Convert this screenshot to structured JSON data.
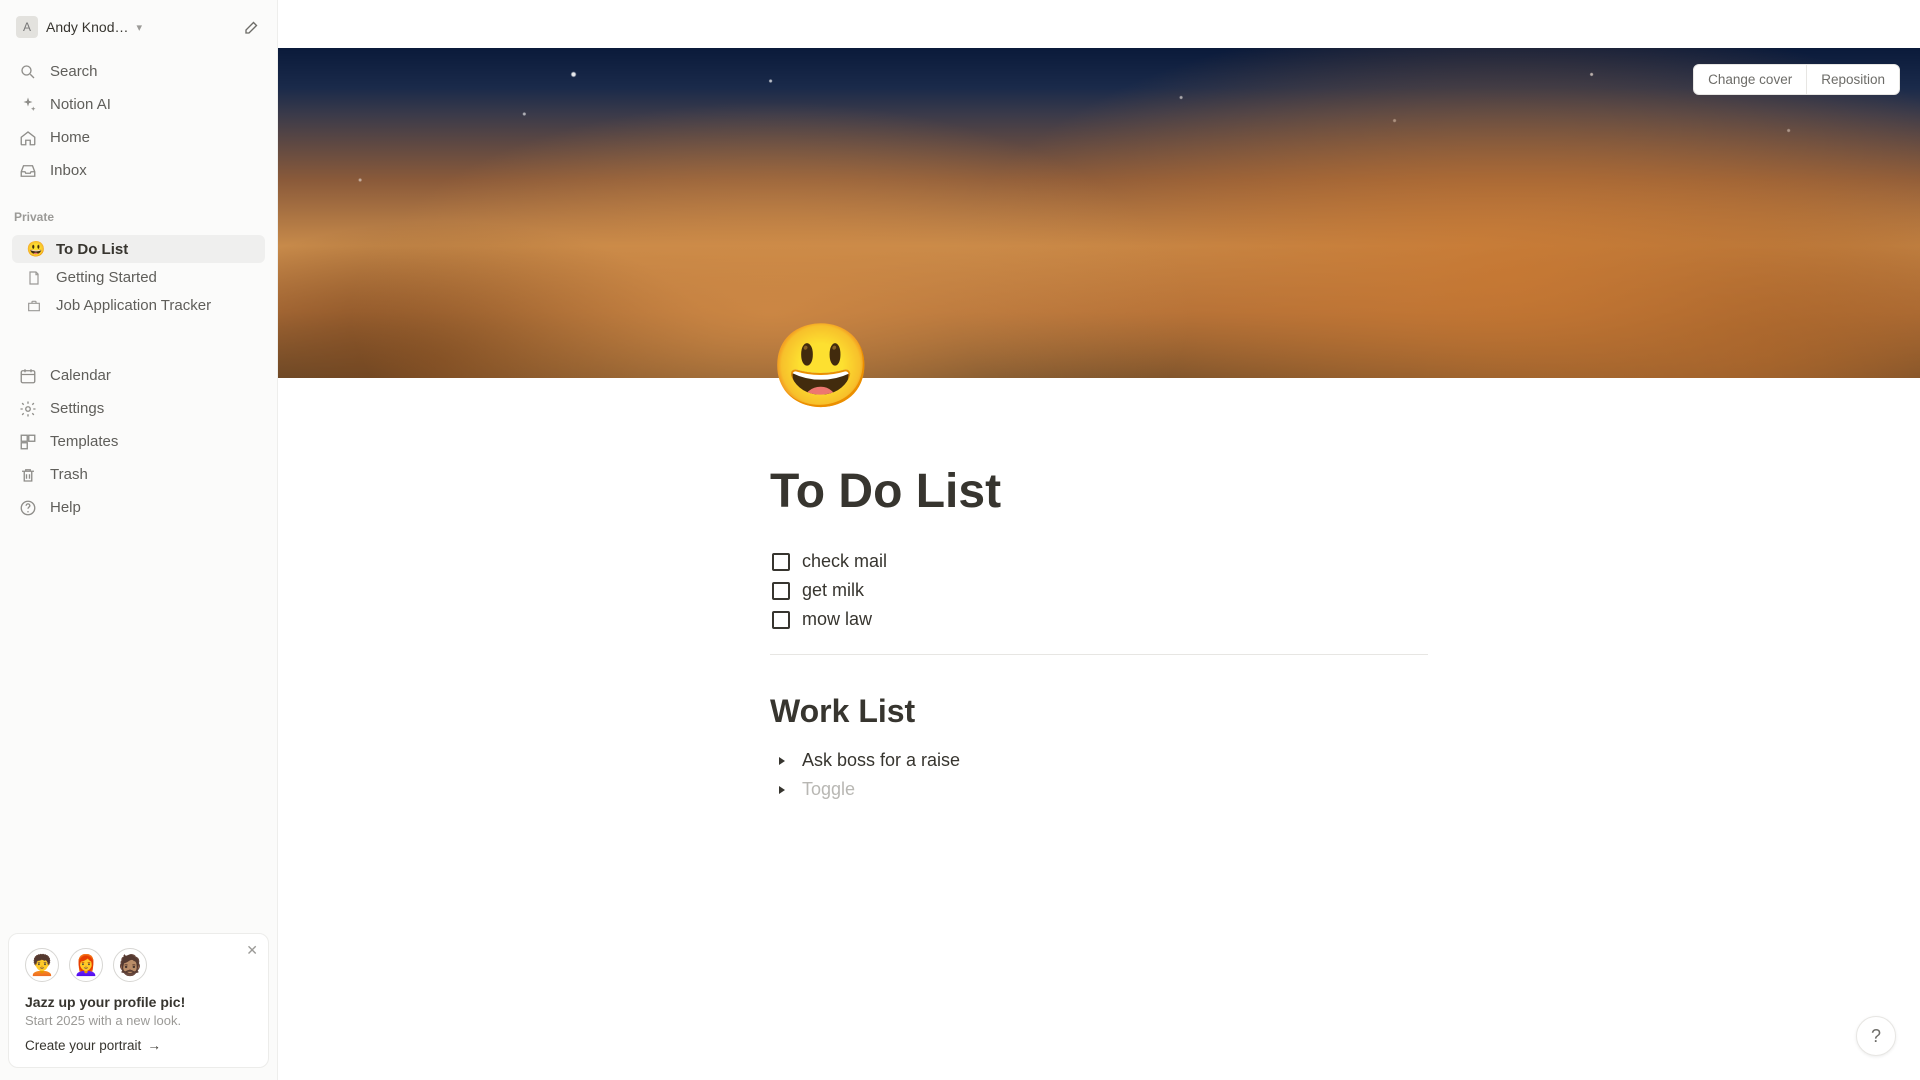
{
  "workspace": {
    "avatar_letter": "A",
    "name": "Andy Knod…"
  },
  "sidebar": {
    "search": "Search",
    "ai": "Notion AI",
    "home": "Home",
    "inbox": "Inbox",
    "private_heading": "Private",
    "pages": [
      {
        "emoji": "😃",
        "label": "To Do List",
        "active": true
      },
      {
        "icon": "doc",
        "label": "Getting Started"
      },
      {
        "icon": "briefcase",
        "label": "Job Application Tracker"
      }
    ],
    "bottom": {
      "calendar": "Calendar",
      "settings": "Settings",
      "templates": "Templates",
      "trash": "Trash",
      "help": "Help"
    }
  },
  "cover": {
    "change": "Change cover",
    "reposition": "Reposition"
  },
  "page": {
    "emoji": "😃",
    "title": "To Do List",
    "todos": [
      "check mail",
      "get milk",
      "mow law"
    ],
    "section2_title": "Work List",
    "toggles": [
      {
        "text": "Ask boss for a raise",
        "placeholder": false
      },
      {
        "text": "Toggle",
        "placeholder": true
      }
    ]
  },
  "promo": {
    "title": "Jazz up your profile pic!",
    "subtitle": "Start 2025 with a new look.",
    "cta": "Create your portrait"
  },
  "help_fab": "?"
}
